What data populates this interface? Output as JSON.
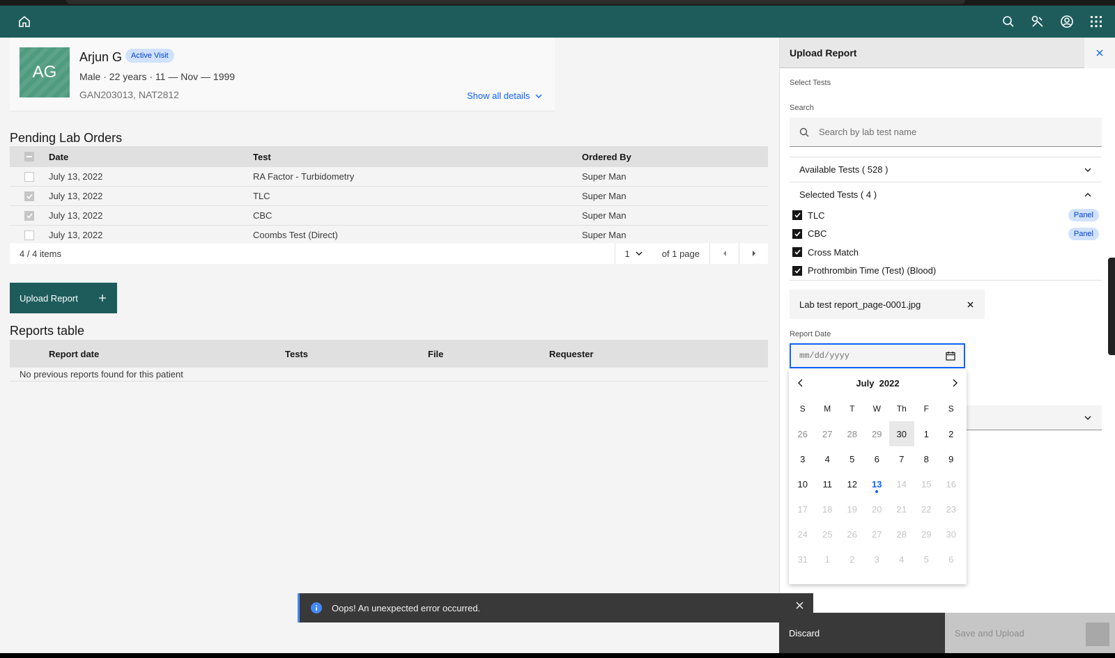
{
  "patient": {
    "initials": "AG",
    "name": "Arjun G",
    "visit_badge": "Active Visit",
    "meta": "Male · 22 years · 11 — Nov — 1999",
    "ids": "GAN203013, NAT2812",
    "show_all": "Show all details"
  },
  "pending": {
    "title": "Pending Lab Orders",
    "columns": [
      "Date",
      "Test",
      "Ordered By"
    ],
    "rows": [
      {
        "date": "July 13, 2022",
        "test": "RA Factor - Turbidometry",
        "by": "Super Man",
        "checked": false
      },
      {
        "date": "July 13, 2022",
        "test": "TLC",
        "by": "Super Man",
        "checked": true
      },
      {
        "date": "July 13, 2022",
        "test": "CBC",
        "by": "Super Man",
        "checked": true
      },
      {
        "date": "July 13, 2022",
        "test": "Coombs Test (Direct)",
        "by": "Super Man",
        "checked": false
      }
    ],
    "items": "4 / 4 items",
    "page": "1",
    "of_page": "of 1 page"
  },
  "upload_button": "Upload Report",
  "reports": {
    "title": "Reports table",
    "columns": [
      "Report date",
      "Tests",
      "File",
      "Requester"
    ],
    "empty": "No previous reports found for this patient"
  },
  "panel": {
    "title": "Upload Report",
    "select_tests": "Select Tests",
    "search_label": "Search",
    "search_placeholder": "Search by lab test name",
    "available": "Available Tests ( 528 )",
    "selected": "Selected Tests ( 4 )",
    "selected_items": [
      {
        "name": "TLC",
        "tag": "Panel"
      },
      {
        "name": "CBC",
        "tag": "Panel"
      },
      {
        "name": "Cross Match",
        "tag": ""
      },
      {
        "name": "Prothrombin Time (Test) (Blood)",
        "tag": ""
      }
    ],
    "file_name": "Lab test report_page-0001.jpg",
    "report_date_label": "Report Date",
    "date_placeholder": "mm/dd/yyyy"
  },
  "calendar": {
    "month": "July",
    "year": "2022",
    "weekdays": [
      "S",
      "M",
      "T",
      "W",
      "Th",
      "F",
      "S"
    ],
    "weeks": [
      [
        {
          "d": "26",
          "s": "mut"
        },
        {
          "d": "27",
          "s": "mut"
        },
        {
          "d": "28",
          "s": "mut"
        },
        {
          "d": "29",
          "s": "mut"
        },
        {
          "d": "30",
          "s": "hov"
        },
        {
          "d": "1",
          "s": ""
        },
        {
          "d": "2",
          "s": ""
        }
      ],
      [
        {
          "d": "3",
          "s": ""
        },
        {
          "d": "4",
          "s": ""
        },
        {
          "d": "5",
          "s": ""
        },
        {
          "d": "6",
          "s": ""
        },
        {
          "d": "7",
          "s": ""
        },
        {
          "d": "8",
          "s": ""
        },
        {
          "d": "9",
          "s": ""
        }
      ],
      [
        {
          "d": "10",
          "s": ""
        },
        {
          "d": "11",
          "s": ""
        },
        {
          "d": "12",
          "s": ""
        },
        {
          "d": "13",
          "s": "today"
        },
        {
          "d": "14",
          "s": "dis"
        },
        {
          "d": "15",
          "s": "dis"
        },
        {
          "d": "16",
          "s": "dis"
        }
      ],
      [
        {
          "d": "17",
          "s": "dis"
        },
        {
          "d": "18",
          "s": "dis"
        },
        {
          "d": "19",
          "s": "dis"
        },
        {
          "d": "20",
          "s": "dis"
        },
        {
          "d": "21",
          "s": "dis"
        },
        {
          "d": "22",
          "s": "dis"
        },
        {
          "d": "23",
          "s": "dis"
        }
      ],
      [
        {
          "d": "24",
          "s": "dis"
        },
        {
          "d": "25",
          "s": "dis"
        },
        {
          "d": "26",
          "s": "dis"
        },
        {
          "d": "27",
          "s": "dis"
        },
        {
          "d": "28",
          "s": "dis"
        },
        {
          "d": "29",
          "s": "dis"
        },
        {
          "d": "30",
          "s": "dis"
        }
      ],
      [
        {
          "d": "31",
          "s": "dis"
        },
        {
          "d": "1",
          "s": "dis"
        },
        {
          "d": "2",
          "s": "dis"
        },
        {
          "d": "3",
          "s": "dis"
        },
        {
          "d": "4",
          "s": "dis"
        },
        {
          "d": "5",
          "s": "dis"
        },
        {
          "d": "6",
          "s": "dis"
        }
      ]
    ]
  },
  "toast": "Oops! An unexpected error occurred.",
  "footer": {
    "discard": "Discard",
    "save": "Save and Upload"
  },
  "colors": {
    "header": "#1e5c5c",
    "accent": "#0f62fe",
    "tag_bg": "#d0e2ff"
  }
}
